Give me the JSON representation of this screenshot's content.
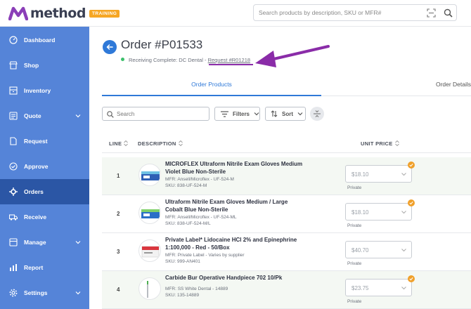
{
  "app": {
    "name": "method",
    "badge": "TRAINING",
    "search_placeholder": "Search products by description, SKU or MFR#"
  },
  "sidebar": {
    "items": [
      {
        "label": "Dashboard",
        "icon": "dashboard-icon"
      },
      {
        "label": "Shop",
        "icon": "shop-icon"
      },
      {
        "label": "Inventory",
        "icon": "inventory-icon"
      },
      {
        "label": "Quote",
        "icon": "quote-icon",
        "has_submenu": true
      },
      {
        "label": "Request",
        "icon": "request-icon"
      },
      {
        "label": "Approve",
        "icon": "approve-icon"
      },
      {
        "label": "Orders",
        "icon": "orders-icon",
        "active": true
      },
      {
        "label": "Receive",
        "icon": "receive-icon"
      },
      {
        "label": "Manage",
        "icon": "manage-icon",
        "has_submenu": true
      },
      {
        "label": "Report",
        "icon": "report-icon"
      },
      {
        "label": "Settings",
        "icon": "settings-icon",
        "has_submenu": true
      }
    ]
  },
  "order": {
    "title": "Order #P01533",
    "status": "Receiving Complete: DC Dental",
    "separator": "-",
    "request_link": "Request #R01218"
  },
  "tabs": [
    {
      "label": "Order Products",
      "active": true
    },
    {
      "label": "Order Details",
      "active": false
    }
  ],
  "toolbar": {
    "search_placeholder": "Search",
    "filters_label": "Filters",
    "sort_label": "Sort"
  },
  "table": {
    "headers": {
      "line": "LINE",
      "description": "DESCRIPTION",
      "unit_price": "UNIT PRICE"
    },
    "rows": [
      {
        "line": "1",
        "name": "MICROFLEX Ultraform Nitrile Exam Gloves Medium Violet Blue Non-Sterile",
        "mfr": "MFR: Ansell/Microflex - UF-524-M",
        "sku": "SKU: 838-UF-524-M",
        "price": "$18.10",
        "price_type": "Private",
        "shaded": true
      },
      {
        "line": "2",
        "name": "Ultraform Nitrile Exam Gloves Medium / Large Cobalt Blue Non-Sterile",
        "mfr": "MFR: Ansell/Microflex - UF-524-ML",
        "sku": "SKU: 838-UF-524-M/L",
        "price": "$18.10",
        "price_type": "Private",
        "shaded": false
      },
      {
        "line": "3",
        "name": "Private Label* Lidocaine HCl 2% and Epinephrine 1:100,000 - Red - 50/Box",
        "mfr": "MFR: Private Label - Varies by supplier",
        "sku": "SKU: 999-AN401",
        "price": "$40.70",
        "price_type": "Private",
        "shaded": false
      },
      {
        "line": "4",
        "name": "Carbide Bur Operative Handpiece 702 10/Pk",
        "mfr": "MFR: SS White Dental - 14889",
        "sku": "SKU: 135-14889",
        "price": "$23.75",
        "price_type": "Private",
        "shaded": true
      }
    ]
  },
  "colors": {
    "sidebar": "#5584d8",
    "sidebar_active": "#2b56a5",
    "accent": "#2f79d8",
    "annotation": "#8a2ca8",
    "badge": "#f6a623",
    "status_dot": "#3cc06b"
  }
}
